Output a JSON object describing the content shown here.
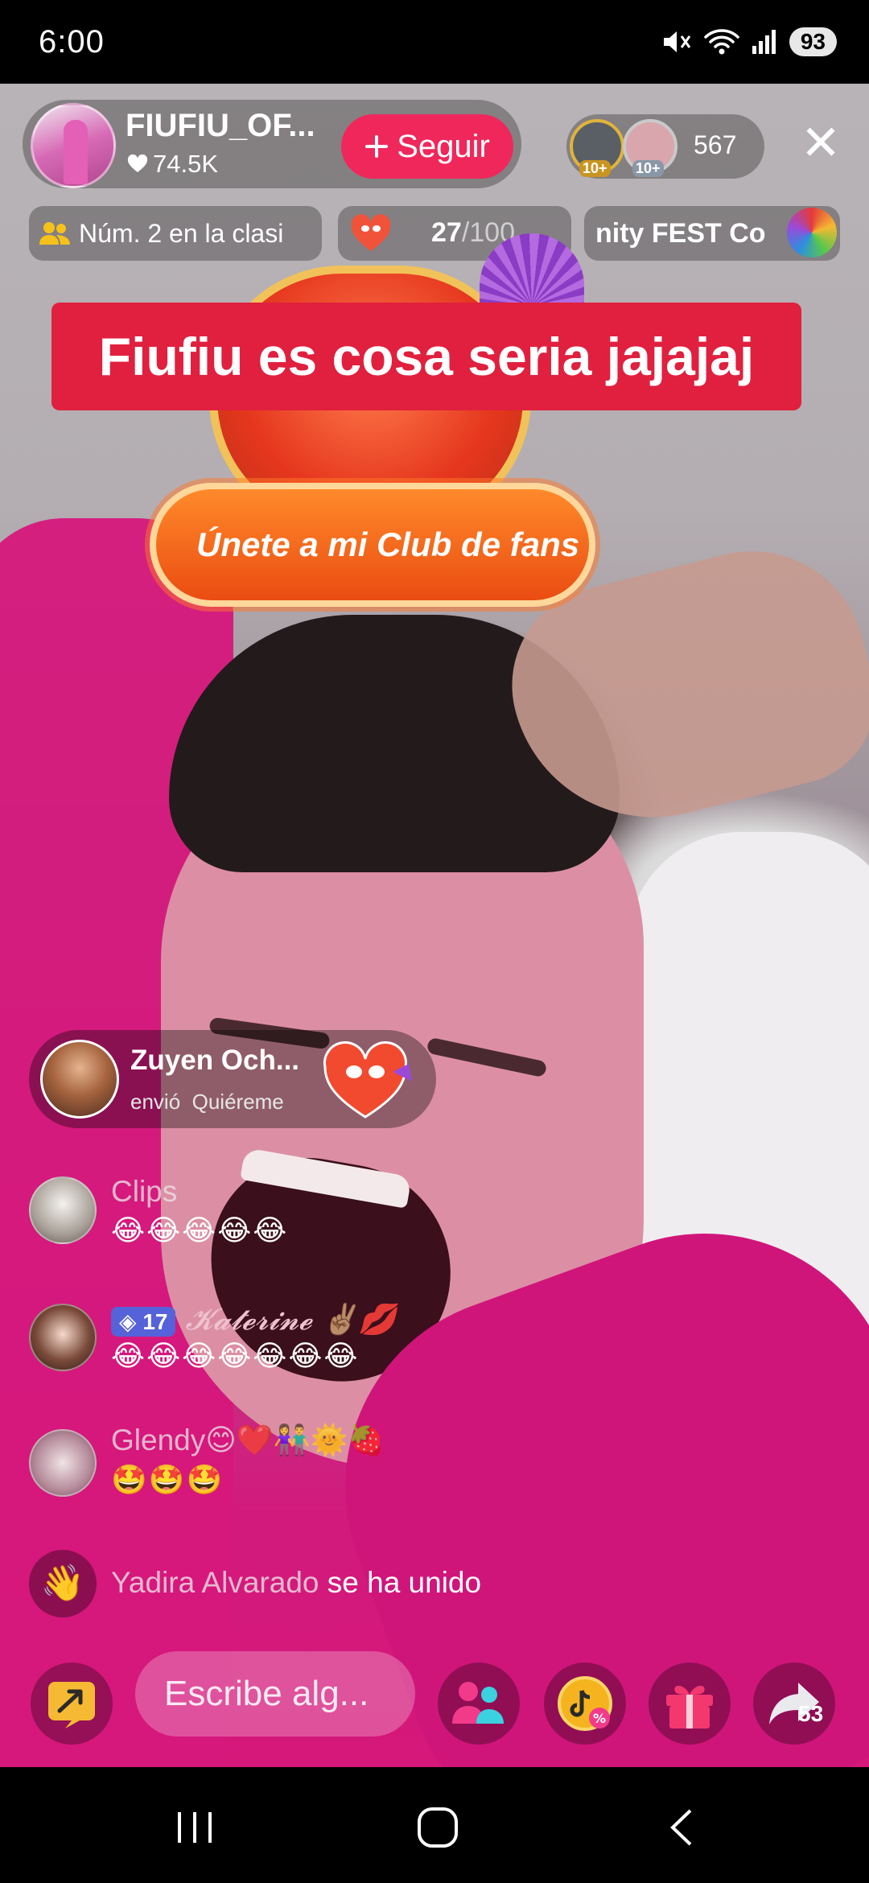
{
  "status_bar": {
    "time": "6:00",
    "battery": "93",
    "icons": [
      "mute-icon",
      "wifi-icon",
      "signal-icon",
      "battery-icon"
    ]
  },
  "live": {
    "host": {
      "name": "FIUFIU_OF...",
      "likes": "74.5K",
      "follow_label": "Seguir"
    },
    "viewers": {
      "badges": [
        "10+",
        "10+"
      ],
      "count": "567"
    },
    "rank_label": "Núm. 2 en la clasi",
    "goal": {
      "current": "27",
      "total": "/100"
    },
    "event_label": "nity FEST   Co",
    "pinned_comment": "Fiufiu es cosa seria jajajaj",
    "fan_club_button": "Únete a mi Club de fans"
  },
  "gift_notice": {
    "user": "Zuyen Och...",
    "action": "envió",
    "gift_name": "Quiéreme"
  },
  "chat": [
    {
      "name": "Clips",
      "message": "😂😂😂😂😂"
    },
    {
      "level": "17",
      "name": "𝓚𝓪𝓽𝓮𝓻𝓲𝓷𝓮 ✌🏽💋",
      "message": "😂😂😂😂😂😂😂"
    },
    {
      "name": "Glendy😊❤️👫🌞🍓",
      "message": "🤩🤩🤩"
    }
  ],
  "join_notice": {
    "name": "Yadira Alvarado",
    "action": "se ha unido"
  },
  "bottom_bar": {
    "comment_placeholder": "Escribe alg...",
    "share_count": "53"
  },
  "colors": {
    "accent": "#f0275b",
    "banner": "#e0203e",
    "fan_club": "#ea4c12",
    "level_badge": "#5662d9"
  }
}
